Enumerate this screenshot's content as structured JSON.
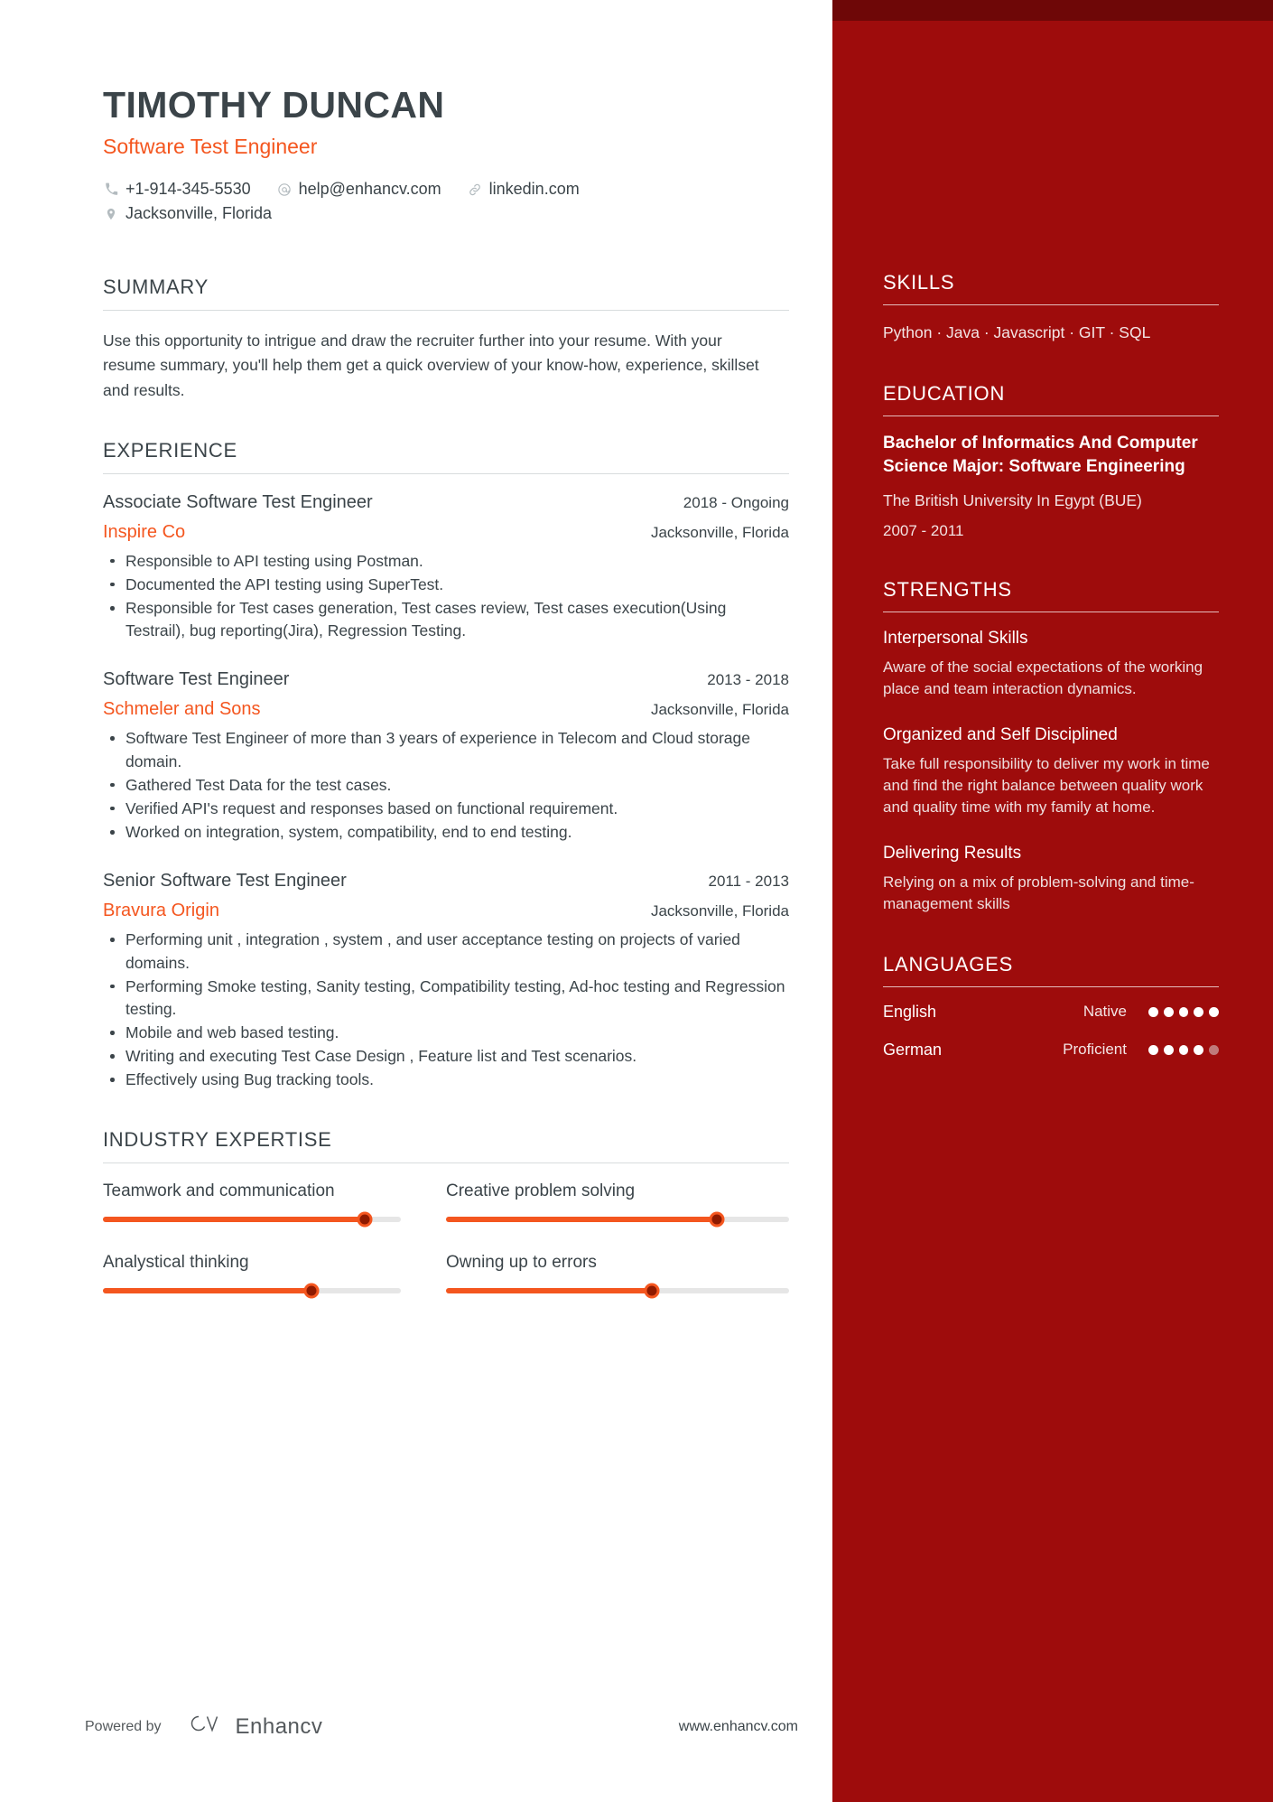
{
  "theme": {
    "accent_orange": "#f4561f",
    "sidebar_red": "#9e0c0c",
    "sidebar_top_band": "#6e0707",
    "text_dark": "#3b4449"
  },
  "header": {
    "name": "TIMOTHY DUNCAN",
    "job_title": "Software Test Engineer",
    "contacts": [
      {
        "icon": "phone-icon",
        "text": "+1-914-345-5530"
      },
      {
        "icon": "email-icon",
        "text": "help@enhancv.com"
      },
      {
        "icon": "link-icon",
        "text": "linkedin.com"
      }
    ],
    "location": {
      "icon": "location-pin-icon",
      "text": "Jacksonville, Florida"
    }
  },
  "summary": {
    "heading": "SUMMARY",
    "text": "Use this opportunity to intrigue and draw the recruiter further into your resume. With your resume summary, you'll help them get a quick overview of your know-how, experience, skillset and results."
  },
  "experience": {
    "heading": "EXPERIENCE",
    "jobs": [
      {
        "role": "Associate Software Test Engineer",
        "company": "Inspire Co",
        "dates": "2018 - Ongoing",
        "location": "Jacksonville, Florida",
        "bullets": [
          "Responsible to API testing using Postman.",
          "Documented the API testing using SuperTest.",
          "Responsible for Test cases generation, Test cases review, Test cases execution(Using Testrail), bug reporting(Jira), Regression Testing."
        ]
      },
      {
        "role": "Software Test Engineer",
        "company": "Schmeler and Sons",
        "dates": "2013 - 2018",
        "location": "Jacksonville, Florida",
        "bullets": [
          "Software Test Engineer of more than 3 years of experience in Telecom and Cloud storage domain.",
          "Gathered Test Data for the test cases.",
          "Verified API's request and responses based on functional requirement.",
          "Worked on integration, system, compatibility, end to end testing."
        ]
      },
      {
        "role": "Senior Software Test Engineer",
        "company": "Bravura Origin",
        "dates": "2011 - 2013",
        "location": "Jacksonville, Florida",
        "bullets": [
          "Performing unit , integration , system , and user acceptance testing on projects of varied domains.",
          "Performing Smoke testing, Sanity testing, Compatibility testing, Ad-hoc testing and Regression testing.",
          "Mobile and web based testing.",
          "Writing and executing Test Case Design , Feature list and Test scenarios.",
          "Effectively using Bug tracking tools."
        ]
      }
    ]
  },
  "industry_expertise": {
    "heading": "INDUSTRY EXPERTISE",
    "items": [
      {
        "label": "Teamwork and communication",
        "percent": 88
      },
      {
        "label": "Creative problem solving",
        "percent": 79
      },
      {
        "label": "Analystical thinking",
        "percent": 70
      },
      {
        "label": "Owning up to errors",
        "percent": 60
      }
    ]
  },
  "sidebar": {
    "skills": {
      "heading": "SKILLS",
      "list": "Python · Java · Javascript · GIT · SQL"
    },
    "education": {
      "heading": "EDUCATION",
      "degree": "Bachelor of Informatics And Computer Science Major: Software Engineering",
      "school": "The British University In Egypt (BUE)",
      "dates": "2007 - 2011"
    },
    "strengths": {
      "heading": "STRENGTHS",
      "items": [
        {
          "title": "Interpersonal Skills",
          "desc": "Aware of the social expectations of the working place and team interaction dynamics."
        },
        {
          "title": "Organized and Self Disciplined",
          "desc": "Take full responsibility to deliver my work in time and find the right balance between quality work and quality time with my family at home."
        },
        {
          "title": "Delivering Results",
          "desc": "Relying on a mix of problem-solving and time-management skills"
        }
      ]
    },
    "languages": {
      "heading": "LANGUAGES",
      "items": [
        {
          "name": "English",
          "level": "Native",
          "dots_filled": 5,
          "dots_total": 5
        },
        {
          "name": "German",
          "level": "Proficient",
          "dots_filled": 4,
          "dots_total": 5
        }
      ]
    }
  },
  "footer": {
    "powered_by": "Powered by",
    "brand": "Enhancv",
    "url": "www.enhancv.com"
  }
}
